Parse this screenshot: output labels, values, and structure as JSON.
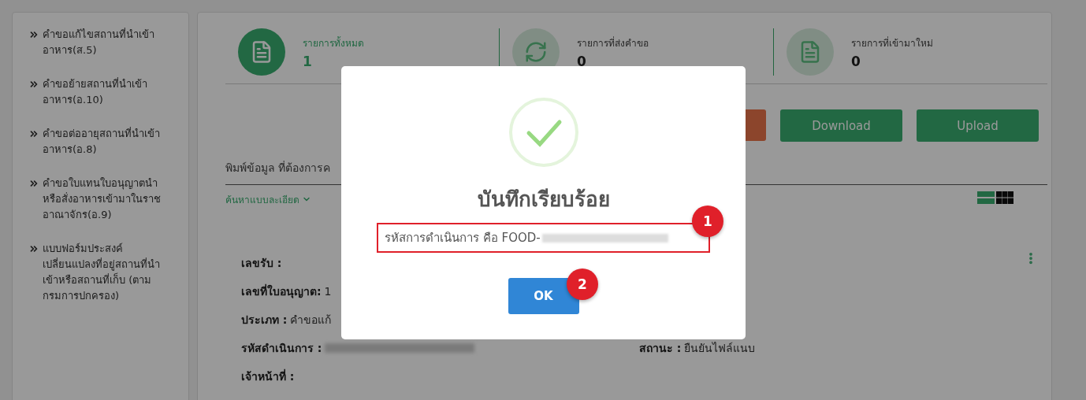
{
  "sidebar": {
    "items": [
      {
        "text": "คำขอแก้ไขสถานที่นำเข้าอาหาร(ส.5)"
      },
      {
        "text": "คำขอย้ายสถานที่นำเข้าอาหาร(อ.10)"
      },
      {
        "text": "คำขอต่ออายุสถานที่นำเข้าอาหาร(อ.8)"
      },
      {
        "text": "คำขอใบแทนใบอนุญาตนำหรือสั่งอาหารเข้ามาในราชอาณาจักร(อ.9)"
      },
      {
        "text": "แบบฟอร์มประสงค์เปลี่ยนแปลงที่อยู่สถานที่นำเข้าหรือสถานที่เก็บ (ตามกรมการปกครอง)"
      }
    ]
  },
  "stats": [
    {
      "label": "รายการทั้งหมด",
      "count": "1",
      "selected": true
    },
    {
      "label": "รายการที่ส่งคำขอ",
      "count": "0",
      "selected": false
    },
    {
      "label": "รายการที่เข้ามาใหม่",
      "count": "0",
      "selected": false
    }
  ],
  "actions": [
    {
      "label": "Download"
    },
    {
      "label": "Upload"
    }
  ],
  "search": {
    "label": "พิมพ์ข้อมูล ที่ต้องการค",
    "advanced": "ค้นหาแบบละเอียด"
  },
  "view_toggle": [
    {
      "kind": "list",
      "selected": true
    },
    {
      "kind": "grid",
      "selected": false
    }
  ],
  "record": {
    "rows": [
      {
        "label": "เลขรับ :"
      },
      {
        "label": "เลขที่ใบอนุญาต:",
        "value": "1"
      },
      {
        "label": "ประเภท :",
        "value": "คำขอแก้"
      },
      {
        "label": "รหัสดำเนินการ :",
        "redacted": true,
        "right": {
          "label": "สถานะ :",
          "value": "ยืนยันไฟล์แนบ"
        }
      },
      {
        "label": "เจ้าหน้าที่ :"
      }
    ]
  },
  "modal": {
    "title": "บันทึกเรียบร้อย",
    "message": "รหัสการดำเนินการ คือ FOOD-",
    "ok": "OK",
    "callouts": [
      "1",
      "2"
    ]
  }
}
